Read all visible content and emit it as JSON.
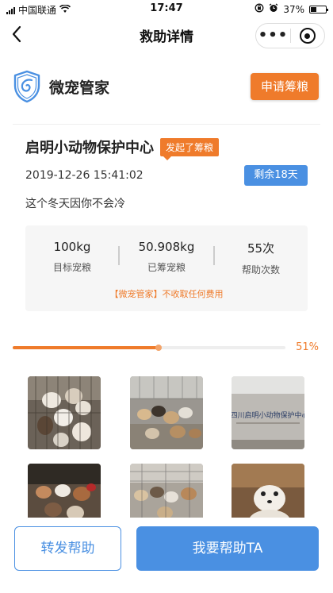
{
  "status_bar": {
    "carrier": "中国联通",
    "time": "17:47",
    "battery": "37%"
  },
  "nav": {
    "title": "救助详情",
    "more_glyph": "•••"
  },
  "org": {
    "name": "微宠管家",
    "apply_label": "申请筹粮",
    "logo_icon": "shield-logo-icon"
  },
  "campaign": {
    "center_name": "启明小动物保护中心",
    "badge": "发起了筹粮",
    "date": "2019-12-26 15:41:02",
    "remaining": "剩余18天",
    "description": "这个冬天因你不会冷"
  },
  "stats": [
    {
      "value": "100kg",
      "label": "目标宠粮"
    },
    {
      "value": "50.908kg",
      "label": "已筹宠粮"
    },
    {
      "value": "55次",
      "label": "帮助次数"
    }
  ],
  "notice": "【微宠管家】不收取任何费用",
  "progress": {
    "percent_text": "51%",
    "fraction": 0.51
  },
  "photos": [
    {
      "name": "photo-dogs-in-cage"
    },
    {
      "name": "photo-dogs-yard"
    },
    {
      "name": "photo-center-wall-sign",
      "sign_text": "四川启明小动物保护中心"
    },
    {
      "name": "photo-dog-pen"
    },
    {
      "name": "photo-dogs-fence"
    },
    {
      "name": "photo-white-dog"
    }
  ],
  "bottom": {
    "share_label": "转发帮助",
    "help_label": "我要帮助TA"
  },
  "colors": {
    "accent_orange": "#ef7b2b",
    "accent_blue": "#4a90e2"
  }
}
